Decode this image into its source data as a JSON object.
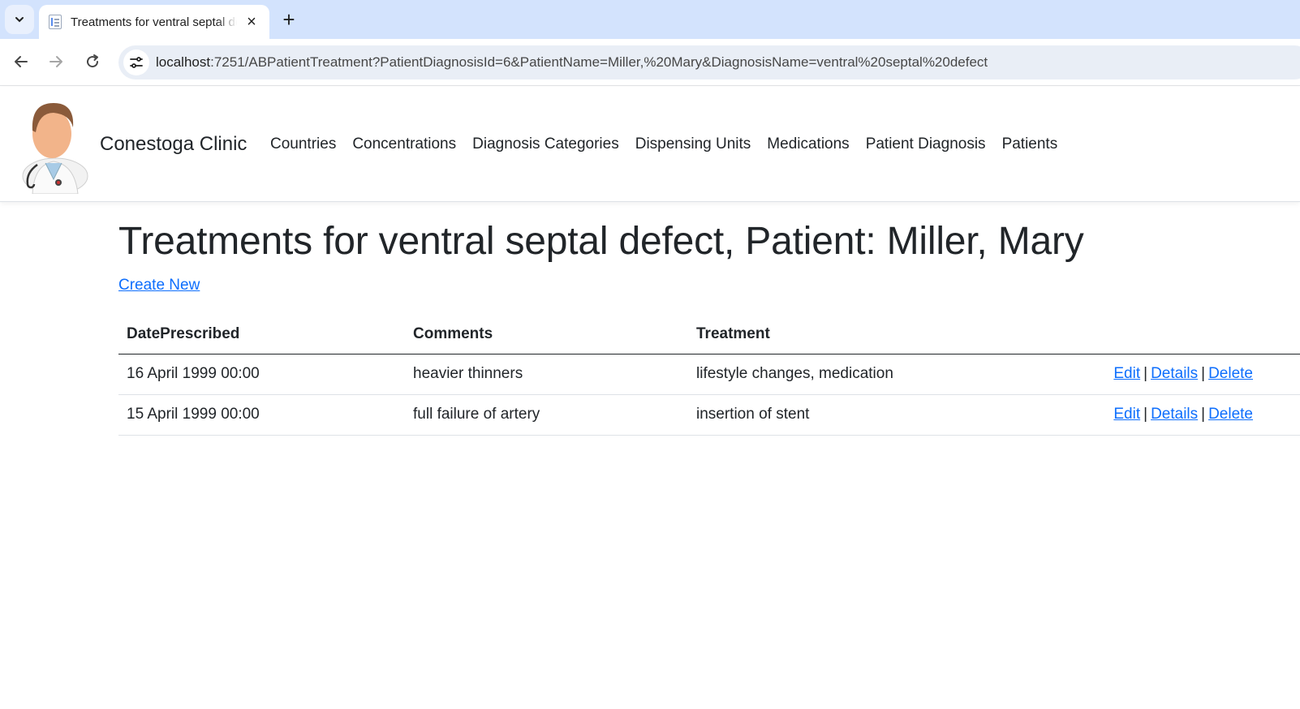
{
  "browser": {
    "tab_title": "Treatments for ventral septal defect",
    "url_host": "localhost",
    "url_path": ":7251/ABPatientTreatment?PatientDiagnosisId=6&PatientName=Miller,%20Mary&DiagnosisName=ventral%20septal%20defect"
  },
  "navbar": {
    "brand": "Conestoga Clinic",
    "links": [
      "Countries",
      "Concentrations",
      "Diagnosis Categories",
      "Dispensing Units",
      "Medications",
      "Patient Diagnosis",
      "Patients"
    ]
  },
  "main": {
    "title": "Treatments for ventral septal defect, Patient: Miller, Mary",
    "create_new": "Create New",
    "table": {
      "headers": [
        "DatePrescribed",
        "Comments",
        "Treatment"
      ],
      "rows": [
        {
          "date": "16 April 1999 00:00",
          "comments": "heavier thinners",
          "treatment": "lifestyle changes, medication"
        },
        {
          "date": "15 April 1999 00:00",
          "comments": "full failure of artery",
          "treatment": "insertion of stent"
        }
      ],
      "actions": {
        "edit": "Edit",
        "details": "Details",
        "delete": "Delete",
        "separator": "|"
      }
    }
  },
  "colors": {
    "link": "#0d6efd",
    "text": "#212529",
    "tabstrip": "#d3e3fd",
    "omnibox": "#e9eef6"
  }
}
